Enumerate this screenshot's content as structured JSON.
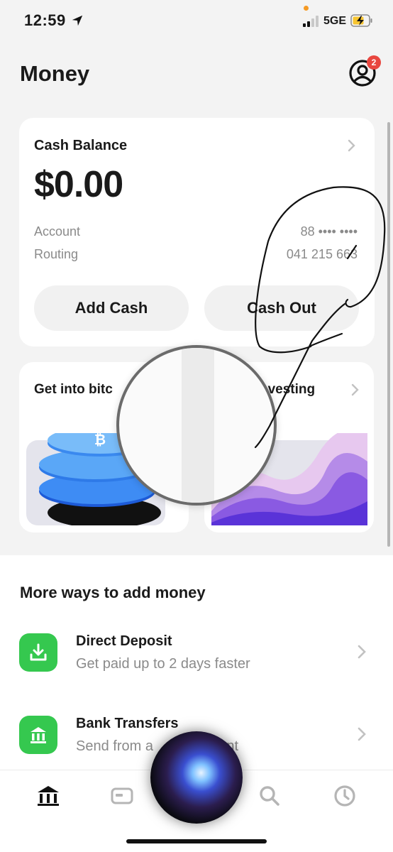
{
  "status_bar": {
    "time": "12:59",
    "network": "5GE"
  },
  "header": {
    "title": "Money",
    "notification_count": "2"
  },
  "balance_card": {
    "label": "Cash Balance",
    "amount": "$0.00",
    "account_label": "Account",
    "account_value": "88 •••• ••••",
    "routing_label": "Routing",
    "routing_value": "041 215 663",
    "add_cash_label": "Add Cash",
    "cash_out_label": "Cash Out"
  },
  "promos": [
    {
      "title": "Get into bitc"
    },
    {
      "title": "nvesting"
    }
  ],
  "more_ways": {
    "title": "More ways to add money",
    "items": [
      {
        "title": "Direct Deposit",
        "subtitle": "Get paid up to 2 days faster",
        "icon": "download-icon"
      },
      {
        "title": "Bank Transfers",
        "subtitle": "Send from a         account",
        "icon": "bank-icon"
      }
    ]
  },
  "tabs": [
    {
      "icon": "bank-icon"
    },
    {
      "icon": "card-icon"
    },
    {
      "icon": "dollar-icon"
    },
    {
      "icon": "search-icon"
    },
    {
      "icon": "clock-icon"
    }
  ],
  "colors": {
    "accent_green": "#35c84f",
    "badge_red": "#e8463f",
    "annotation_ink": "#111111"
  }
}
